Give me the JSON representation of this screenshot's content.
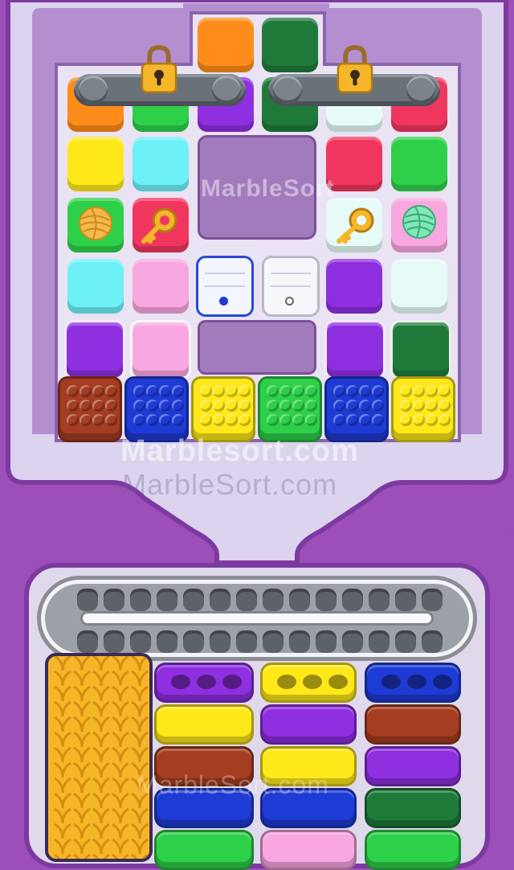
{
  "watermarks": {
    "upper_ghost": "MarbleSort",
    "banner_primary": "Marblesort.com",
    "banner_secondary": "MarbleSort.com",
    "lower_ghost": "MarbleSort.com"
  },
  "colors": {
    "background": "#9c4fb8",
    "board": "#e6dff0",
    "frame": "#b48fd0",
    "orange": "#ff8c1a",
    "dark_green": "#1f7a3a",
    "green": "#2ed04a",
    "purple": "#8e2fe0",
    "yellow": "#ffe81a",
    "cyan": "#6ef0f7",
    "pink": "#f8a7e0",
    "red": "#f0365f",
    "mint": "#e6faf7",
    "brown": "#a43d22",
    "blue": "#1e3bd6",
    "gold": "#f5b629"
  },
  "locks": [
    {
      "name": "left-padlock",
      "locked": true
    },
    {
      "name": "right-padlock",
      "locked": true
    }
  ],
  "grid_tiles": [
    {
      "row": 0,
      "col": 0,
      "color": "orange"
    },
    {
      "row": 0,
      "col": 1,
      "color": "green"
    },
    {
      "row": 0,
      "col": 2,
      "color": "purple"
    },
    {
      "row": 0,
      "col": 3,
      "color": "dark_green"
    },
    {
      "row": 0,
      "col": 4,
      "color": "mint"
    },
    {
      "row": 0,
      "col": 5,
      "color": "red"
    },
    {
      "row": 1,
      "col": 0,
      "color": "yellow"
    },
    {
      "row": 1,
      "col": 1,
      "color": "cyan"
    },
    {
      "row": 1,
      "col": 4,
      "color": "red"
    },
    {
      "row": 1,
      "col": 5,
      "color": "green"
    },
    {
      "row": 2,
      "col": 0,
      "color": "green",
      "item": "yarn-ball-orange"
    },
    {
      "row": 2,
      "col": 1,
      "color": "red",
      "item": "key"
    },
    {
      "row": 2,
      "col": 4,
      "color": "mint",
      "item": "key"
    },
    {
      "row": 2,
      "col": 5,
      "color": "pink",
      "item": "yarn-ball-mint"
    },
    {
      "row": 3,
      "col": 0,
      "color": "cyan"
    },
    {
      "row": 3,
      "col": 1,
      "color": "pink"
    },
    {
      "row": 3,
      "col": 4,
      "color": "purple"
    },
    {
      "row": 3,
      "col": 5,
      "color": "mint"
    },
    {
      "row": 4,
      "col": 0,
      "color": "purple"
    },
    {
      "row": 4,
      "col": 1,
      "color": "pink"
    },
    {
      "row": 4,
      "col": 4,
      "color": "purple"
    },
    {
      "row": 4,
      "col": 5,
      "color": "dark_green"
    }
  ],
  "top_tiles": [
    {
      "color": "orange"
    },
    {
      "color": "dark_green"
    }
  ],
  "pop_blocks": [
    "brown",
    "blue",
    "yellow",
    "green",
    "blue",
    "yellow"
  ],
  "tray_columns": [
    {
      "name": "yarn-column",
      "color": "gold",
      "kind": "yarn"
    },
    {
      "name": "column-2",
      "bars": [
        "purple",
        "yellow",
        "brown",
        "blue",
        "green"
      ]
    },
    {
      "name": "column-3",
      "bars": [
        "yellow",
        "purple",
        "yellow",
        "blue",
        "pink"
      ]
    },
    {
      "name": "column-4",
      "bars": [
        "blue",
        "brown",
        "purple",
        "dark_green",
        "green"
      ]
    }
  ]
}
